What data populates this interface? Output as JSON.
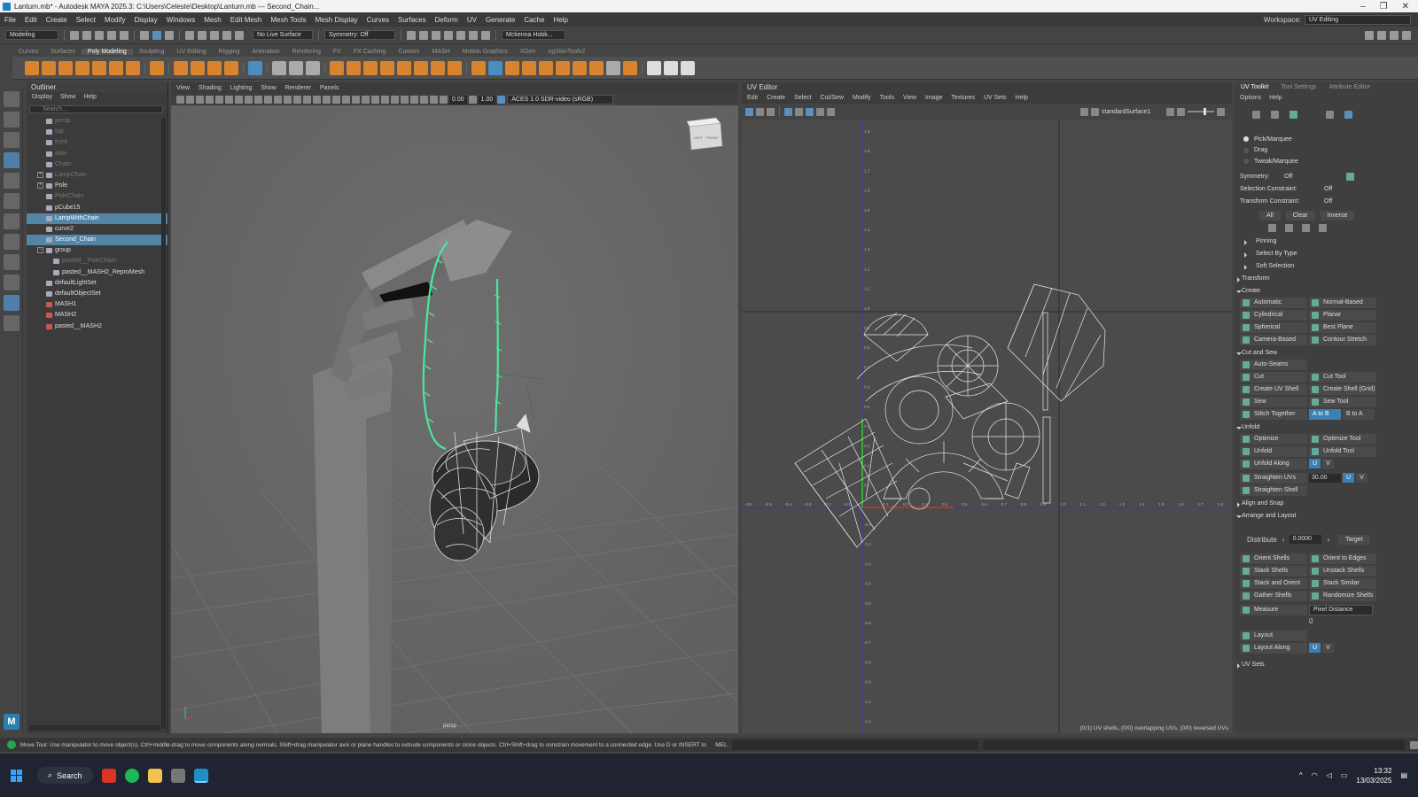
{
  "window": {
    "title": "Lanturn.mb* - Autodesk MAYA 2025.3: C:\\Users\\Celeste\\Desktop\\Lanturn.mb  ---  Second_Chain..."
  },
  "menubar": {
    "items": [
      "File",
      "Edit",
      "Create",
      "Select",
      "Modify",
      "Display",
      "Windows",
      "Mesh",
      "Edit Mesh",
      "Mesh Tools",
      "Mesh Display",
      "Curves",
      "Surfaces",
      "Deform",
      "UV",
      "Generate",
      "Cache",
      "Help"
    ],
    "workspace_label": "Workspace:",
    "workspace_value": "UV Editing"
  },
  "statusline": {
    "mode": "Modeling",
    "live_surface": "No Live Surface",
    "symmetry": "Symmetry: Off",
    "user": "Mckenna Hobk..."
  },
  "shelf": {
    "tabs": [
      "Curves",
      "Surfaces",
      "Poly Modeling",
      "Sculpting",
      "UV Editing",
      "Rigging",
      "Animation",
      "Rendering",
      "FX",
      "FX Caching",
      "Custom",
      "MASH",
      "Motion Graphics",
      "XGen",
      "ngSkinTools2"
    ],
    "active": "Poly Modeling"
  },
  "outliner": {
    "title": "Outliner",
    "menu": [
      "Display",
      "Show",
      "Help"
    ],
    "search_placeholder": "Search...",
    "items": [
      {
        "label": "persp",
        "dim": true,
        "indent": false,
        "selected": false,
        "expand": ""
      },
      {
        "label": "top",
        "dim": true,
        "indent": false,
        "selected": false,
        "expand": ""
      },
      {
        "label": "front",
        "dim": true,
        "indent": false,
        "selected": false,
        "expand": ""
      },
      {
        "label": "side",
        "dim": true,
        "indent": false,
        "selected": false,
        "expand": ""
      },
      {
        "label": "Chain",
        "dim": true,
        "indent": false,
        "selected": false,
        "expand": ""
      },
      {
        "label": "LampChain",
        "dim": true,
        "indent": false,
        "selected": false,
        "expand": "+"
      },
      {
        "label": "Pole",
        "dim": false,
        "indent": false,
        "selected": false,
        "expand": "+"
      },
      {
        "label": "PoleChain",
        "dim": true,
        "indent": false,
        "selected": false,
        "expand": ""
      },
      {
        "label": "pCube15",
        "dim": false,
        "indent": false,
        "selected": false,
        "expand": ""
      },
      {
        "label": "LampWithChain",
        "dim": false,
        "indent": false,
        "selected": true,
        "expand": ""
      },
      {
        "label": "curve2",
        "dim": false,
        "indent": false,
        "selected": false,
        "expand": ""
      },
      {
        "label": "Second_Chain",
        "dim": false,
        "indent": false,
        "selected": true,
        "expand": ""
      },
      {
        "label": "group",
        "dim": false,
        "indent": false,
        "selected": false,
        "expand": "-"
      },
      {
        "label": "pasted__PoleChain",
        "dim": true,
        "indent": true,
        "selected": false,
        "expand": ""
      },
      {
        "label": "pasted__MASH2_ReproMesh",
        "dim": false,
        "indent": true,
        "selected": false,
        "expand": ""
      },
      {
        "label": "defaultLightSet",
        "dim": false,
        "indent": false,
        "selected": false,
        "expand": ""
      },
      {
        "label": "defaultObjectSet",
        "dim": false,
        "indent": false,
        "selected": false,
        "expand": ""
      },
      {
        "label": "MASH1",
        "dim": false,
        "indent": false,
        "selected": false,
        "expand": "",
        "red": true
      },
      {
        "label": "MASH2",
        "dim": false,
        "indent": false,
        "selected": false,
        "expand": "",
        "red": true
      },
      {
        "label": "pasted__MASH2",
        "dim": false,
        "indent": false,
        "selected": false,
        "expand": "",
        "red": true
      }
    ]
  },
  "viewport": {
    "menu": [
      "View",
      "Shading",
      "Lighting",
      "Show",
      "Renderer",
      "Panels"
    ],
    "val1": "0.00",
    "val2": "1.00",
    "colorspace": "ACES 1.0 SDR-video (sRGB)",
    "camera": "persp",
    "cube_left": "LEFT",
    "cube_front": "FRONT"
  },
  "uveditor": {
    "title": "UV Editor",
    "menu": [
      "Edit",
      "Create",
      "Select",
      "Cut/Sew",
      "Modify",
      "Tools",
      "View",
      "Image",
      "Textures",
      "UV Sets",
      "Help"
    ],
    "surface": "standardSurface1",
    "status": "(0/1) UV shells, (0/0) overlapping UVs, (0/0) reversed UVs",
    "ylabels": [
      "1.9",
      "1.8",
      "1.7",
      "1.6",
      "1.5",
      "1.4",
      "1.3",
      "1.2",
      "1.1",
      "1.0",
      "0.9",
      "0.8",
      "0.7",
      "0.6",
      "0.5",
      "0.4",
      "0.3",
      "0.2",
      "0.1",
      "-0.1",
      "-0.2",
      "-0.3",
      "-0.4",
      "-0.5",
      "-0.6",
      "-0.7",
      "-0.8",
      "-0.9",
      "-1.0",
      "-1.1"
    ],
    "xlabels": [
      "-0.6",
      "-0.5",
      "-0.4",
      "-0.3",
      "-0.2",
      "-0.1",
      "0.1",
      "0.2",
      "0.3",
      "0.4",
      "0.5",
      "0.6",
      "0.7",
      "0.8",
      "0.9",
      "1.0",
      "1.1",
      "1.2",
      "1.3",
      "1.4",
      "1.5",
      "1.6",
      "1.7",
      "1.8"
    ]
  },
  "toolkit": {
    "tabs": [
      "UV Toolkit",
      "Tool Settings",
      "Attribute Editor"
    ],
    "menu": [
      "Options",
      "Help"
    ],
    "modes": [
      "Pick/Marquee",
      "Drag",
      "Tweak/Marquee"
    ],
    "symmetry_label": "Symmetry:",
    "symmetry_value": "Off",
    "selcon_label": "Selection Constraint:",
    "selcon_value": "Off",
    "trcon_label": "Transform Constraint:",
    "trcon_value": "Off",
    "sel_buttons": [
      "All",
      "Clear",
      "Inverse"
    ],
    "collapsed1": [
      "Pinning",
      "Select By Type",
      "Soft Selection"
    ],
    "transform": "Transform",
    "create": "Create",
    "create_btns": [
      "Automatic",
      "Normal-Based",
      "Cylindrical",
      "Planar",
      "Spherical",
      "Best Plane",
      "Camera-Based",
      "Contour Stretch"
    ],
    "cutsew": "Cut and Sew",
    "autoseams": "Auto-Seams",
    "cut_btns": [
      "Cut",
      "Cut Tool",
      "Create UV Shell",
      "Create Shell (Grid)",
      "Sew",
      "Sew Tool"
    ],
    "stitch": "Stitch Together",
    "atob": "A to B",
    "btoa": "B to A",
    "unfold": "Unfold",
    "unfold_btns": [
      "Optimize",
      "Optimize Tool",
      "Unfold",
      "Unfold Tool"
    ],
    "unfold_along": "Unfold Along",
    "u": "U",
    "v": "V",
    "straighten": "Straighten UVs",
    "straighten_val": "30.00",
    "straighten_shell": "Straighten Shell",
    "align": "Align and Snap",
    "arrange": "Arrange and Layout",
    "distribute": "Distribute",
    "distribute_val": "0.0000",
    "target": "Target",
    "arrange_btns": [
      "Orient Shells",
      "Orient to Edges",
      "Stack Shells",
      "Unstack Shells",
      "Stack and Orient",
      "Stack Similar",
      "Gather Shells",
      "Randomize Shells"
    ],
    "measure": "Measure",
    "measure_mode": "Pixel Distance",
    "measure_val": "0",
    "layout": "Layout",
    "layout_along": "Layout Along",
    "uvsets": "UV Sets"
  },
  "helpline": {
    "text": "Move Tool: Use manipulator to move object(s). Ctrl+middle-drag to move components along normals. Shift+drag manipulator axis or plane handles to extrude components or clone objects. Ctrl+Shift+drag to constrain movement to a connected edge. Use D or INSERT to change th",
    "mel": "MEL"
  },
  "taskbar": {
    "search": "Search",
    "time": "13:32",
    "date": "13/03/2025"
  },
  "colors": {
    "chain": "#4de6a0",
    "selection": "#5285a6",
    "accent": "#3c7fb3"
  }
}
